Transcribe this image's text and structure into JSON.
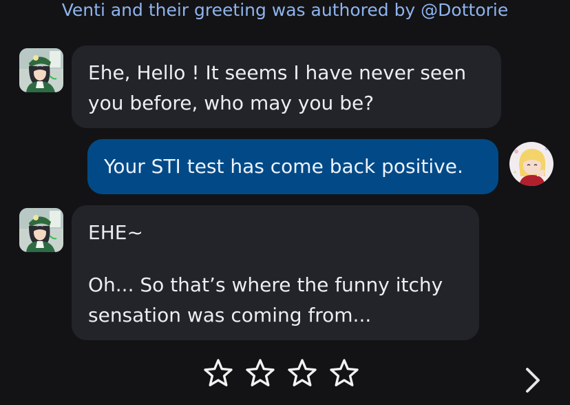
{
  "header": {
    "attribution": "Venti and their greeting was authored by @Dottorie"
  },
  "messages": [
    {
      "sender": "bot",
      "paragraphs": [
        "Ehe, Hello ! It seems I have never seen you before, who may you be?"
      ]
    },
    {
      "sender": "user",
      "paragraphs": [
        "Your STI test has come back positive."
      ]
    },
    {
      "sender": "bot",
      "paragraphs": [
        "EHE~",
        "Oh... So that’s where the funny itchy sensation was coming from..."
      ]
    }
  ],
  "rating": {
    "max": 5,
    "stars_shown": 4,
    "value": 0,
    "icon": "star-outline-icon"
  },
  "navigation": {
    "next_icon": "chevron-right-icon"
  },
  "colors": {
    "background": "#131316",
    "bot_bubble": "#232429",
    "user_bubble": "#024a87",
    "attribution_text": "#8fb4ec"
  }
}
